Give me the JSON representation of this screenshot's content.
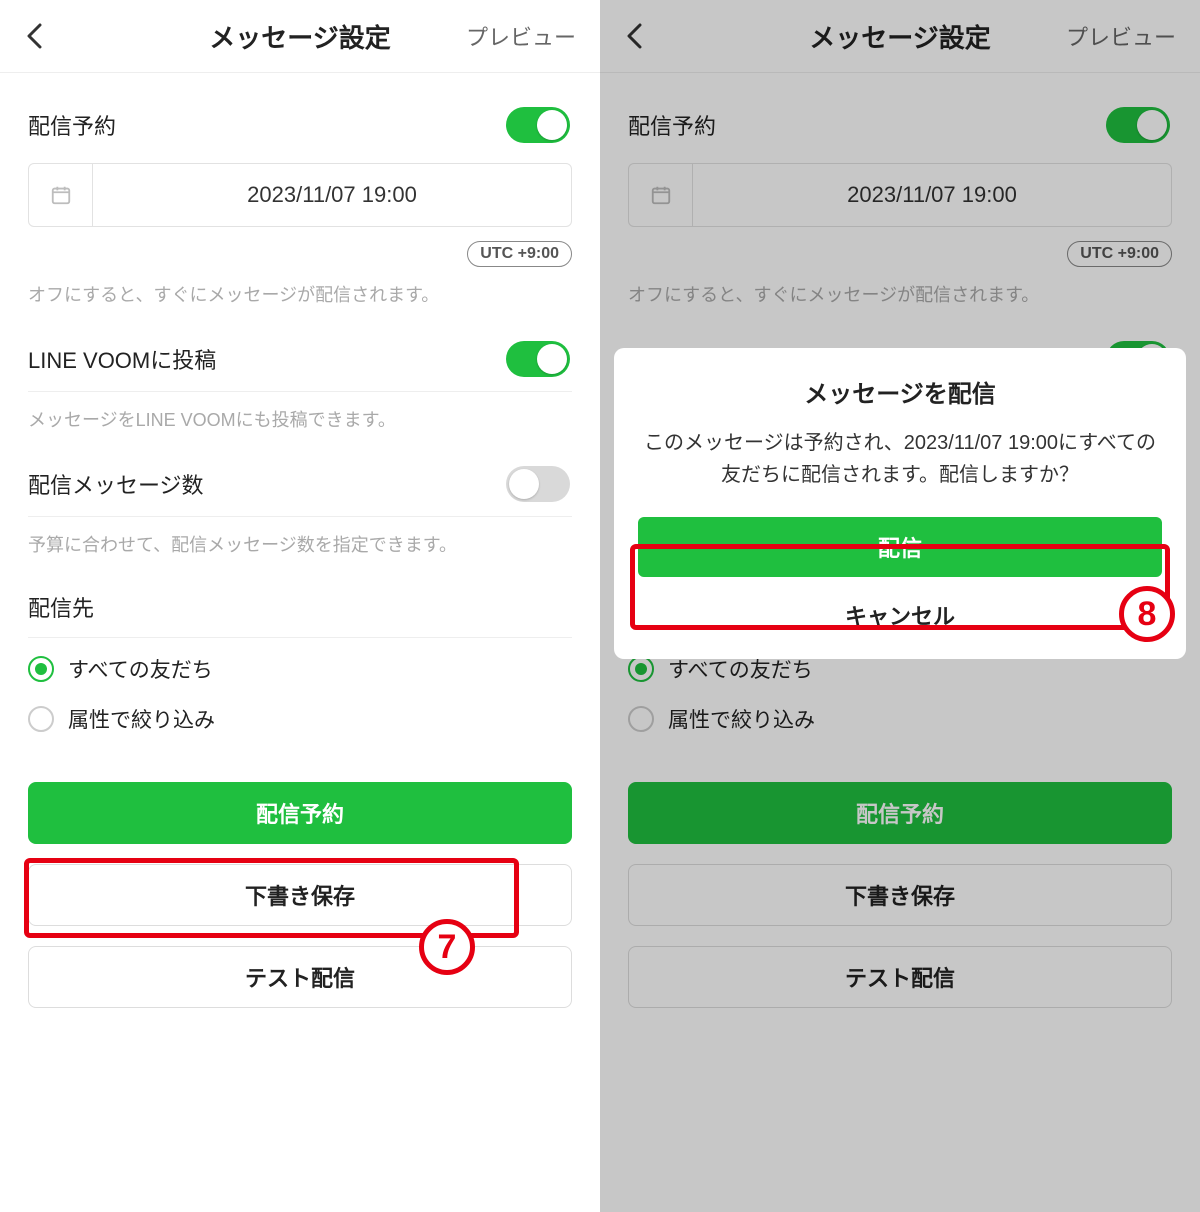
{
  "header": {
    "title": "メッセージ設定",
    "preview": "プレビュー"
  },
  "schedule": {
    "label": "配信予約",
    "datetime": "2023/11/07 19:00",
    "utc": "UTC +9:00",
    "helper": "オフにすると、すぐにメッセージが配信されます。"
  },
  "voom": {
    "label": "LINE VOOMに投稿",
    "helper": "メッセージをLINE VOOMにも投稿できます。"
  },
  "count": {
    "label": "配信メッセージ数",
    "helper": "予算に合わせて、配信メッセージ数を指定できます。"
  },
  "audience": {
    "label": "配信先",
    "options": {
      "all": "すべての友だち",
      "filter": "属性で絞り込み"
    }
  },
  "buttons": {
    "schedule_send": "配信予約",
    "save_draft": "下書き保存",
    "send_test": "テスト配信"
  },
  "dialog": {
    "title": "メッセージを配信",
    "body": "このメッセージは予約され、2023/11/07 19:00にすべての友だちに配信されます。配信しますか？",
    "send": "配信",
    "cancel": "キャンセル"
  },
  "annotations": {
    "seven": "7",
    "eight": "8"
  }
}
